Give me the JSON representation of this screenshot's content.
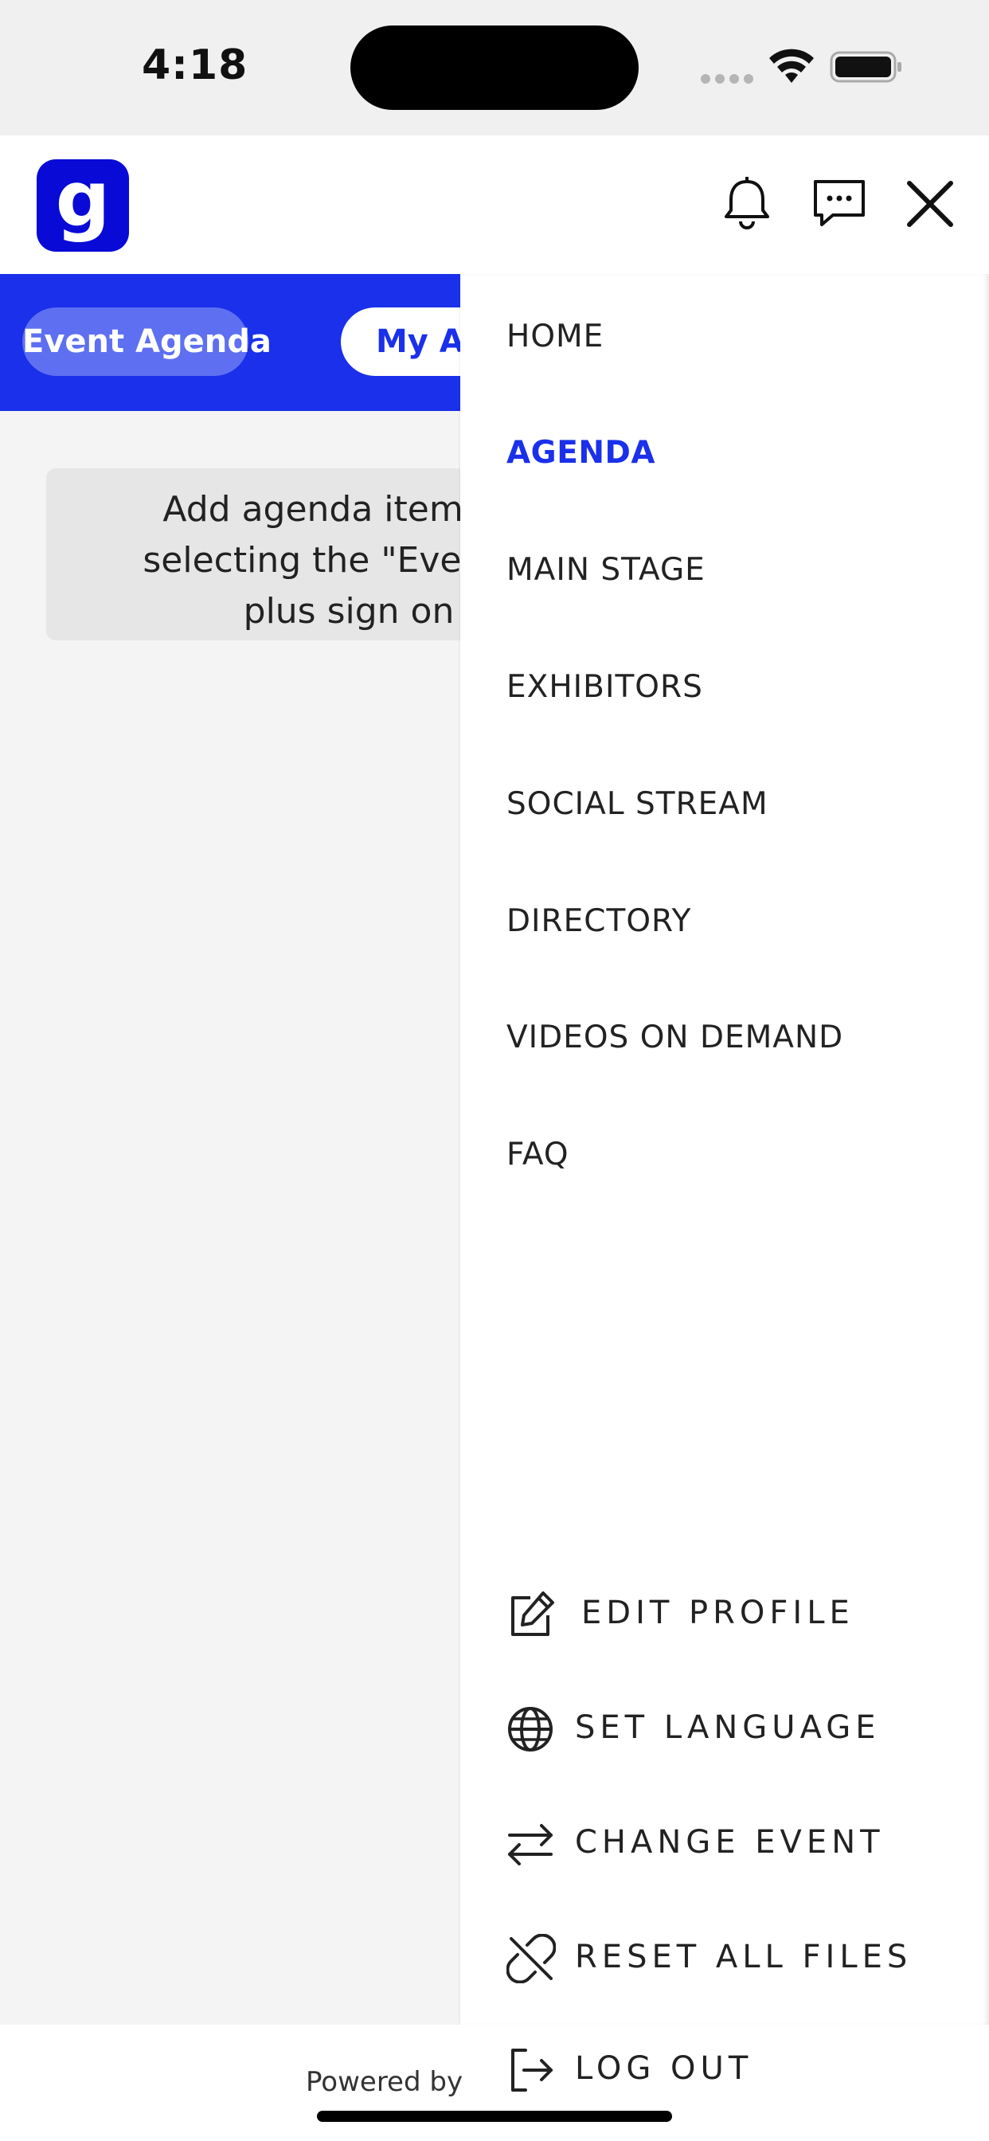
{
  "status_bar": {
    "time": "4:18"
  },
  "header": {
    "logo_letter": "g"
  },
  "tabs": [
    {
      "label": "Event Agenda"
    },
    {
      "label": "My Agenda"
    }
  ],
  "agenda_message": {
    "line1": "Add agenda items yo",
    "line2": "selecting the \"Event Ag",
    "line3": "plus sign on"
  },
  "drawer": {
    "menu_items": [
      {
        "label": "HOME"
      },
      {
        "label": "AGENDA",
        "active": true
      },
      {
        "label": "MAIN STAGE"
      },
      {
        "label": "EXHIBITORS"
      },
      {
        "label": "SOCIAL STREAM"
      },
      {
        "label": "DIRECTORY"
      },
      {
        "label": "VIDEOS ON DEMAND"
      },
      {
        "label": "FAQ"
      }
    ],
    "bottom_items": [
      {
        "label": "EDIT PROFILE",
        "icon": "edit-icon"
      },
      {
        "label": "SET LANGUAGE",
        "icon": "globe-icon"
      },
      {
        "label": "CHANGE EVENT",
        "icon": "swap-arrows-icon"
      },
      {
        "label": "RESET ALL FILES",
        "icon": "broken-link-icon"
      },
      {
        "label": "LOG OUT",
        "icon": "logout-icon"
      }
    ]
  },
  "footer": {
    "powered_by": "Powered by"
  },
  "colors": {
    "brand_blue": "#1a30ea",
    "logo_blue": "#0a0ad6",
    "tab_inactive": "#5e70f1"
  }
}
